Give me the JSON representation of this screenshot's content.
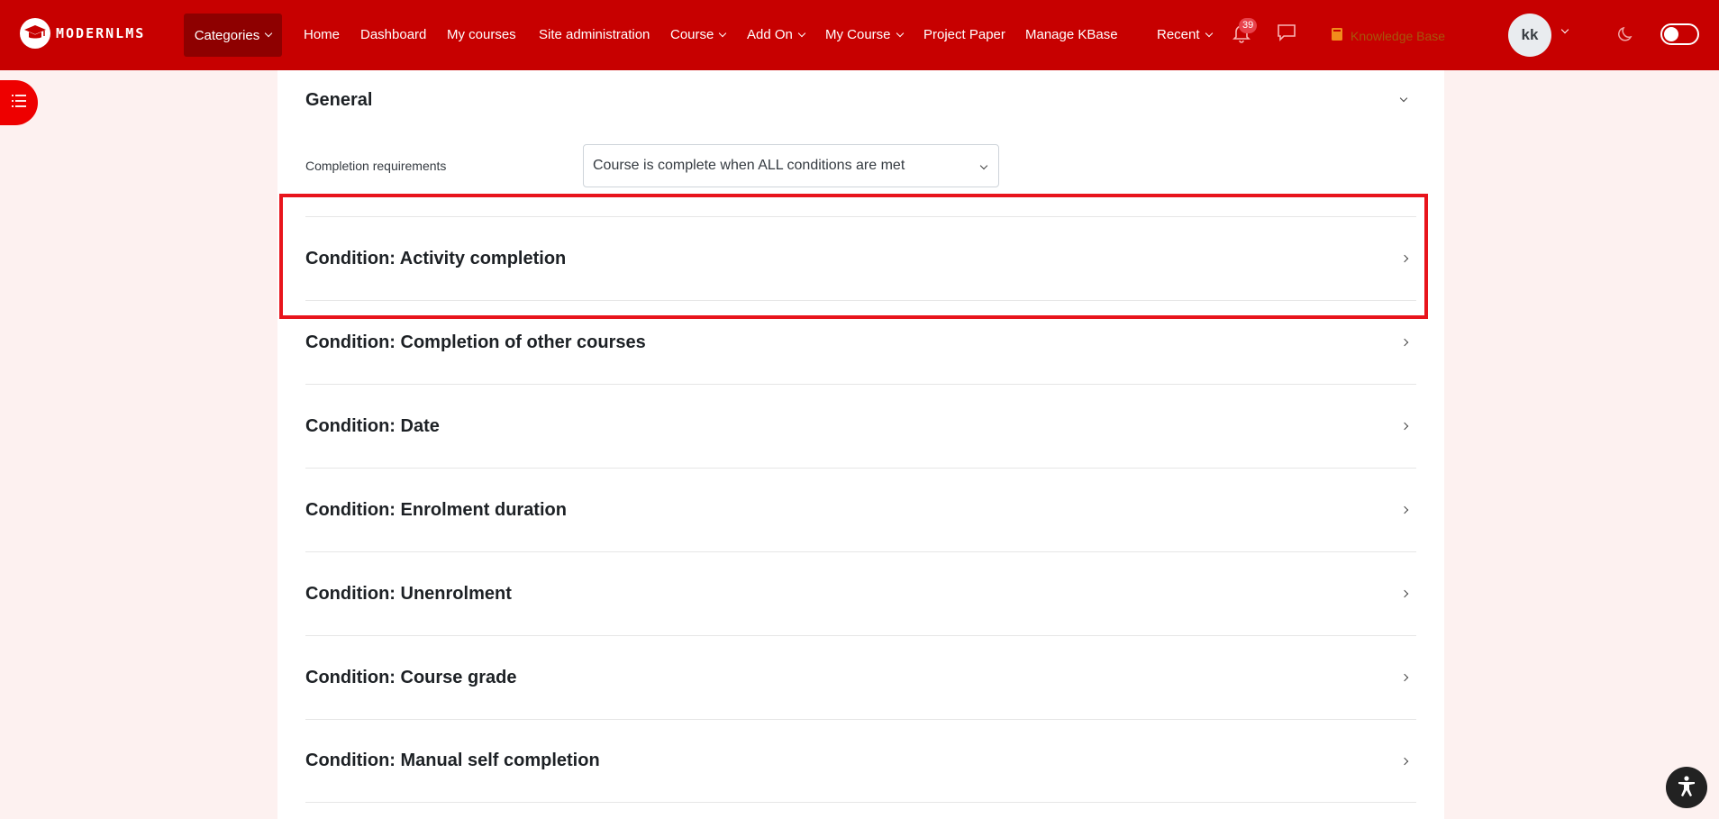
{
  "brand": {
    "logo_text": "MODERNLMS"
  },
  "nav": {
    "categories": "Categories",
    "links": [
      {
        "label": "Home"
      },
      {
        "label": "Dashboard"
      },
      {
        "label": "My courses"
      },
      {
        "label": "Site administration"
      },
      {
        "label": "Course"
      },
      {
        "label": "Add On"
      },
      {
        "label": "My Course"
      },
      {
        "label": "Project Paper"
      },
      {
        "label": "Manage KBase"
      },
      {
        "label": "Recent"
      }
    ],
    "notifications_count": "39",
    "knowledge_base": "Knowledge Base",
    "user_initials": "kk"
  },
  "general": {
    "heading": "General",
    "completion_label": "Completion requirements",
    "completion_value": "Course is complete when ALL conditions are met"
  },
  "conditions": [
    {
      "label": "Condition: Activity completion"
    },
    {
      "label": "Condition: Completion of other courses"
    },
    {
      "label": "Condition: Date"
    },
    {
      "label": "Condition: Enrolment duration"
    },
    {
      "label": "Condition: Unenrolment"
    },
    {
      "label": "Condition: Course grade"
    },
    {
      "label": "Condition: Manual self completion"
    }
  ],
  "colors": {
    "navbar": "#c70000",
    "highlight": "#e8141c",
    "badge": "#e8424b"
  },
  "icons": [
    "logo-icon",
    "bell-icon",
    "chat-icon",
    "book-icon",
    "moon-icon",
    "menu-icon",
    "accessibility-icon"
  ]
}
